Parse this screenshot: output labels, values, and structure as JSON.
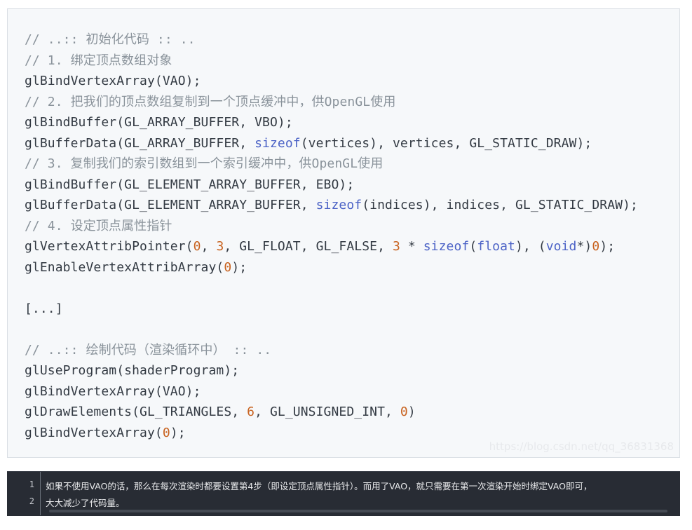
{
  "code_block": {
    "language": "cpp",
    "lines": [
      [
        {
          "text": "// ..:: 初始化代码 :: ..",
          "type": "comment"
        }
      ],
      [
        {
          "text": "// 1. 绑定顶点数组对象",
          "type": "comment"
        }
      ],
      [
        {
          "text": "glBindVertexArray(VAO);",
          "type": "plain"
        }
      ],
      [
        {
          "text": "// 2. 把我们的顶点数组复制到一个顶点缓冲中，供OpenGL使用",
          "type": "comment"
        }
      ],
      [
        {
          "text": "glBindBuffer(GL_ARRAY_BUFFER, VBO);",
          "type": "plain"
        }
      ],
      [
        {
          "text": "glBufferData(GL_ARRAY_BUFFER, ",
          "type": "plain"
        },
        {
          "text": "sizeof",
          "type": "keyword"
        },
        {
          "text": "(vertices), vertices, GL_STATIC_DRAW);",
          "type": "plain"
        }
      ],
      [
        {
          "text": "// 3. 复制我们的索引数组到一个索引缓冲中，供OpenGL使用",
          "type": "comment"
        }
      ],
      [
        {
          "text": "glBindBuffer(GL_ELEMENT_ARRAY_BUFFER, EBO);",
          "type": "plain"
        }
      ],
      [
        {
          "text": "glBufferData(GL_ELEMENT_ARRAY_BUFFER, ",
          "type": "plain"
        },
        {
          "text": "sizeof",
          "type": "keyword"
        },
        {
          "text": "(indices), indices, GL_STATIC_DRAW);",
          "type": "plain"
        }
      ],
      [
        {
          "text": "// 4. 设定顶点属性指针",
          "type": "comment"
        }
      ],
      [
        {
          "text": "glVertexAttribPointer(",
          "type": "plain"
        },
        {
          "text": "0",
          "type": "number"
        },
        {
          "text": ", ",
          "type": "plain"
        },
        {
          "text": "3",
          "type": "number"
        },
        {
          "text": ", GL_FLOAT, GL_FALSE, ",
          "type": "plain"
        },
        {
          "text": "3",
          "type": "number"
        },
        {
          "text": " * ",
          "type": "plain"
        },
        {
          "text": "sizeof",
          "type": "keyword"
        },
        {
          "text": "(",
          "type": "plain"
        },
        {
          "text": "float",
          "type": "keyword"
        },
        {
          "text": "), (",
          "type": "plain"
        },
        {
          "text": "void",
          "type": "keyword"
        },
        {
          "text": "*)",
          "type": "plain"
        },
        {
          "text": "0",
          "type": "number"
        },
        {
          "text": ");",
          "type": "plain"
        }
      ],
      [
        {
          "text": "glEnableVertexAttribArray(",
          "type": "plain"
        },
        {
          "text": "0",
          "type": "number"
        },
        {
          "text": ");",
          "type": "plain"
        }
      ],
      [],
      [
        {
          "text": "[...]",
          "type": "plain"
        }
      ],
      [],
      [
        {
          "text": "// ..:: 绘制代码（渲染循环中） :: ..",
          "type": "comment"
        }
      ],
      [
        {
          "text": "glUseProgram(shaderProgram);",
          "type": "plain"
        }
      ],
      [
        {
          "text": "glBindVertexArray(VAO);",
          "type": "plain"
        }
      ],
      [
        {
          "text": "glDrawElements(GL_TRIANGLES, ",
          "type": "plain"
        },
        {
          "text": "6",
          "type": "number"
        },
        {
          "text": ", GL_UNSIGNED_INT, ",
          "type": "plain"
        },
        {
          "text": "0",
          "type": "number"
        },
        {
          "text": ")",
          "type": "plain"
        }
      ],
      [
        {
          "text": "glBindVertexArray(",
          "type": "plain"
        },
        {
          "text": "0",
          "type": "number"
        },
        {
          "text": ");",
          "type": "plain"
        }
      ]
    ],
    "watermark": "https://blog.csdn.net/qq_36831368"
  },
  "note_block": {
    "lines": [
      {
        "number": "1",
        "text": "    如果不使用VAO的话，那么在每次渲染时都要设置第4步（即设定顶点属性指针）。而用了VAO，就只需要在第一次渲染开始时绑定VAO即可，"
      },
      {
        "number": "2",
        "text": "大大减少了代码量。"
      }
    ]
  },
  "colors": {
    "code_background": "#f6f8fa",
    "comment": "#8a939b",
    "plain": "#333a43",
    "keyword": "#4b62c6",
    "number": "#c8621f",
    "note_background": "#282c34",
    "note_text": "#e9eaec"
  }
}
